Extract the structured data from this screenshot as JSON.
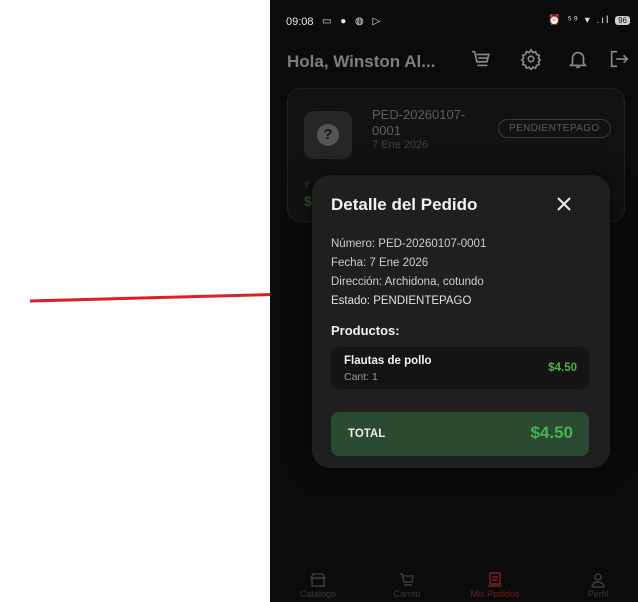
{
  "status_bar": {
    "time": "09:08",
    "left_icons": "▭ ● ◍ ▷",
    "right_icons": "⏰ ⁵⁹ ▾ .ıl",
    "battery": "96"
  },
  "header": {
    "greeting": "Hola, Winston  Al...",
    "icons": [
      "cart-icon",
      "settings-icon",
      "bell-icon",
      "logout-icon"
    ]
  },
  "background_order": {
    "number": "PED-20260107-0001",
    "date": "7 Ene 2026",
    "status": "PENDIENTEPAGO",
    "total_prefix": "T",
    "amount_prefix": "$"
  },
  "modal": {
    "title": "Detalle del Pedido",
    "number_line": "Número: PED-20260107-0001",
    "date_line": "Fecha: 7 Ene 2026",
    "address_line": "Dirección: Archidona, cotundo",
    "status_line": "Estado: PENDIENTEPAGO",
    "products_heading": "Productos:",
    "products": [
      {
        "name": "Flautas de pollo",
        "qty": "Cant: 1",
        "price": "$4.50"
      }
    ],
    "total_label": "TOTAL",
    "total_value": "$4.50"
  },
  "bottom_nav": [
    {
      "label": "Catálogo",
      "icon": "store-icon",
      "active": false
    },
    {
      "label": "Carrito",
      "icon": "cart-icon",
      "active": false
    },
    {
      "label": "Mis Pedidos",
      "icon": "orders-icon",
      "active": true
    },
    {
      "label": "Perfil",
      "icon": "profile-icon",
      "active": false
    }
  ],
  "colors": {
    "accent_green": "#4caf50",
    "total_bg": "#2a4a31",
    "active_nav": "#6d2222",
    "arrow": "#e02020"
  }
}
